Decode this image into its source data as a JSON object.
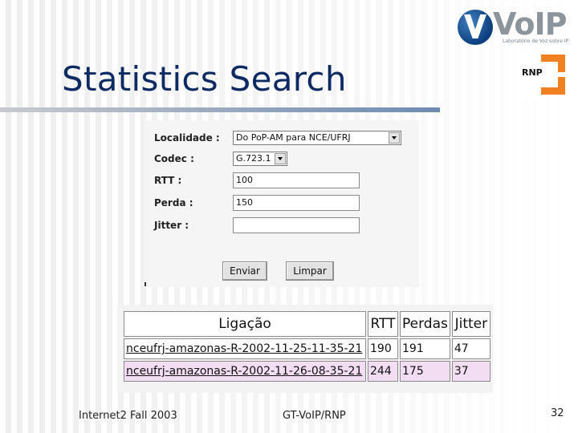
{
  "slide": {
    "title": "Statistics Search",
    "footer_left": "Internet2 Fall 2003",
    "footer_center": "GT-VoIP/RNP",
    "page_number": "32"
  },
  "logos": {
    "voip_text": "VoIP",
    "voip_tagline": "Laboratório de Voz sobre IP",
    "rnp_text": "RNP"
  },
  "form": {
    "localidade_label": "Localidade :",
    "localidade_value": "Do PoP-AM para NCE/UFRJ",
    "codec_label": "Codec :",
    "codec_value": "G.723.1",
    "rtt_label": "RTT :",
    "rtt_value": "100",
    "perda_label": "Perda :",
    "perda_value": "150",
    "jitter_label": "Jitter :",
    "jitter_value": "",
    "enviar_label": "Enviar",
    "limpar_label": "Limpar"
  },
  "results": {
    "headers": [
      "Ligação",
      "RTT",
      "Perdas",
      "Jitter"
    ],
    "rows": [
      {
        "ligacao": "nceufrj-amazonas-R-2002-11-25-11-35-21",
        "rtt": "190",
        "perdas": "191",
        "jitter": "47"
      },
      {
        "ligacao": "nceufrj-amazonas-R-2002-11-26-08-35-21",
        "rtt": "244",
        "perdas": "175",
        "jitter": "37"
      }
    ]
  },
  "colors": {
    "title": "#0d2a63",
    "rnp_orange": "#f08020",
    "highlight_row": "#f2ddf2",
    "link": "#1a1a8c"
  }
}
